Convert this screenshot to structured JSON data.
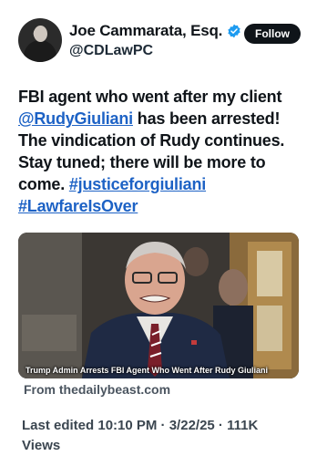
{
  "author": {
    "display_name": "Joe Cammarata, Esq.",
    "handle": "@CDLawPC",
    "verified_icon": "verified-badge-icon"
  },
  "follow_label": "Follow",
  "tweet": {
    "text_part1": "FBI agent who went after my client ",
    "mention": "@RudyGiuliani",
    "text_part2": "  has been arrested! The vindication of Rudy continues. Stay tuned; there will be more to come. ",
    "hashtag1": "#justiceforgiuliani",
    "hashtag2": "#LawfareIsOver"
  },
  "card": {
    "caption": "Trump Admin Arrests FBI Agent Who Went After Rudy Giuliani",
    "source": "From thedailybeast.com"
  },
  "meta": {
    "edited_label": "Last edited 10:10 PM · 3/22/25",
    "separator": " · ",
    "views_count": "111K",
    "views_label": "Views"
  },
  "colors": {
    "link": "#1d62c5",
    "verified": "#1d9bf0",
    "button_bg": "#0f1419"
  }
}
